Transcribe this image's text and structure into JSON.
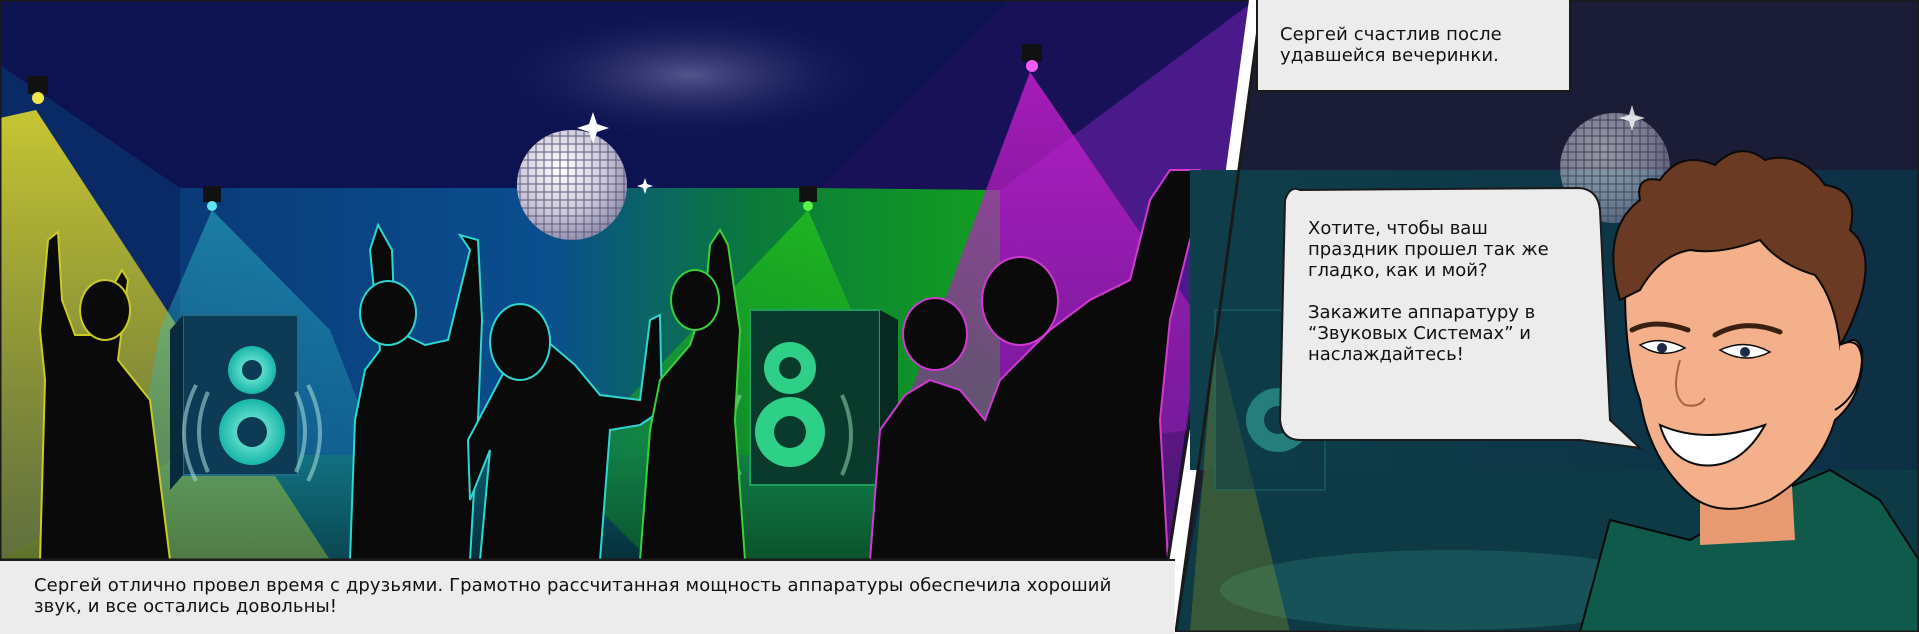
{
  "panels": {
    "left": {
      "caption": "Сергей отлично провел время с друзьями. Грамотно рассчитанная мощность аппаратуры обеспечила хороший звук, и все остались довольны!"
    },
    "right": {
      "caption": "Сергей счастлив после удавшейся вечеринки.",
      "speech_bubble": {
        "line1": "Хотите, чтобы ваш праздник прошел так же гладко, как и мой?",
        "line2": "Закажите аппаратуру в “Звуковых Системах” и наслаждайтесь!"
      }
    }
  },
  "colors": {
    "spot_yellow": "#d6d62a",
    "spot_cyan": "#2fd6d0",
    "spot_green": "#22c40a",
    "spot_magenta": "#c01cc8",
    "ceiling_navy": "#0d1250",
    "caption_bg": "#ececec",
    "skin": "#f3b08a",
    "hair": "#6a3a22",
    "shirt": "#0f5a4a"
  }
}
